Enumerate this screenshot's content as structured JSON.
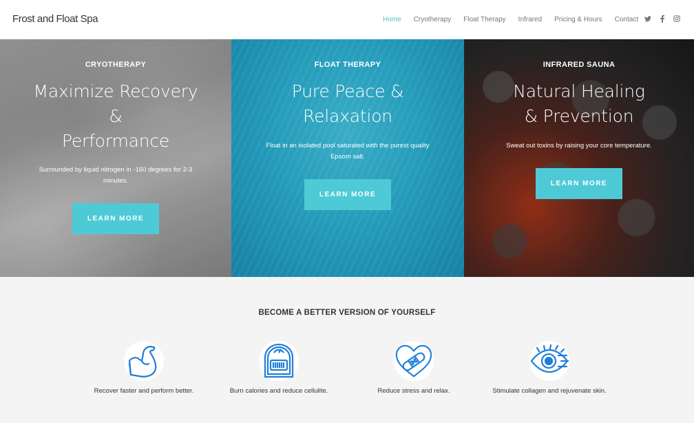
{
  "brand": "Frost and Float Spa",
  "nav": {
    "items": [
      {
        "label": "Home",
        "active": true
      },
      {
        "label": "Cryotherapy",
        "active": false
      },
      {
        "label": "Float Therapy",
        "active": false
      },
      {
        "label": "Infrared",
        "active": false
      },
      {
        "label": "Pricing & Hours",
        "active": false
      },
      {
        "label": "Contact",
        "active": false
      }
    ],
    "social": [
      "twitter-icon",
      "facebook-icon",
      "instagram-icon"
    ]
  },
  "hero": {
    "panels": [
      {
        "kicker": "CRYOTHERAPY",
        "headline_lines": [
          "Maximize Recovery",
          "&",
          "Performance"
        ],
        "description": "Surrounded by liquid nitrogen in -160 degrees for 2-3 minutes.",
        "button": "LEARN MORE"
      },
      {
        "kicker": "FLOAT THERAPY",
        "headline_lines": [
          "Pure Peace &",
          "Relaxation"
        ],
        "description": "Float in an isolated pool saturated with the purest quality Epsom salt.",
        "button": "LEARN MORE"
      },
      {
        "kicker": "INFRARED SAUNA",
        "headline_lines": [
          "Natural Healing",
          "& Prevention"
        ],
        "description": "Sweat out toxins by raising your core temperature.",
        "button": "LEARN MORE"
      }
    ]
  },
  "benefits": {
    "title": "BECOME A BETTER VERSION OF YOURSELF",
    "items": [
      {
        "icon": "flexed-arm-icon",
        "caption": "Recover faster and perform better."
      },
      {
        "icon": "scale-icon",
        "caption": "Burn calories and reduce cellulite."
      },
      {
        "icon": "heart-bandage-icon",
        "caption": "Reduce stress and relax."
      },
      {
        "icon": "eye-icon",
        "caption": "Stimulate collagen and rejuvenate skin."
      }
    ]
  },
  "colors": {
    "accent": "#4ecad6",
    "nav_active": "#4ec1cd",
    "icon_blue": "#1e7fd8",
    "section_bg": "#f4f4f4"
  }
}
